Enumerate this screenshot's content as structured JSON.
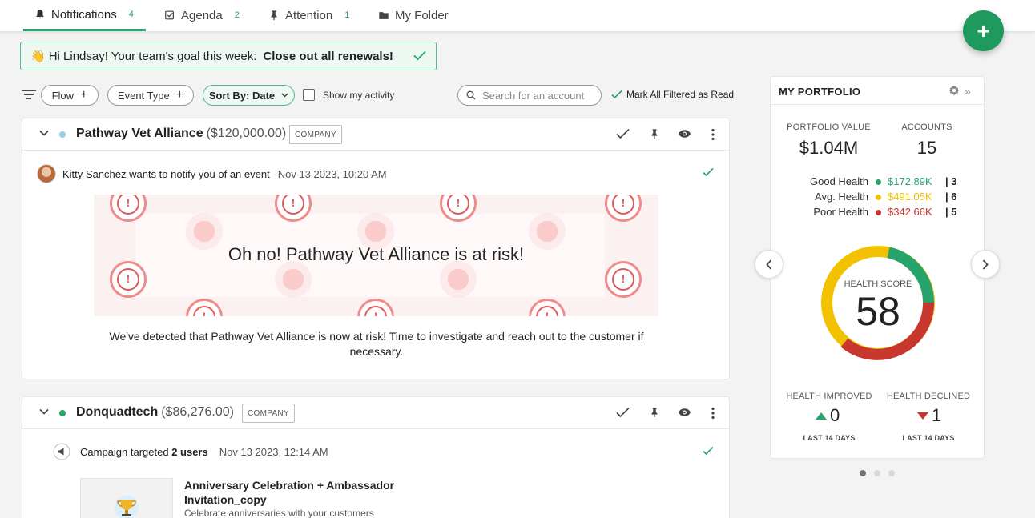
{
  "tabs": [
    {
      "label": "Notifications",
      "count": "4",
      "icon": "bell-icon"
    },
    {
      "label": "Agenda",
      "count": "2",
      "icon": "checklist-icon"
    },
    {
      "label": "Attention",
      "count": "1",
      "icon": "pin-icon"
    },
    {
      "label": "My Folder",
      "count": "",
      "icon": "folder-icon"
    }
  ],
  "fab": {
    "symbol": "+"
  },
  "goal": {
    "emoji": "👋",
    "text": "Hi Lindsay! Your team's goal this week:",
    "highlight": "Close out all renewals!"
  },
  "filters": {
    "flow": "Flow",
    "event_type": "Event Type",
    "sort": "Sort By: Date",
    "show_activity": "Show my activity",
    "search_placeholder": "Search for an account",
    "mark_read": "Mark All Filtered as Read"
  },
  "cards": [
    {
      "name": "Pathway Vet Alliance",
      "value": "($120,000.00)",
      "badge": "COMPANY",
      "dot_color": "#9ccbe8",
      "event_text": "Kitty Sanchez wants to notify you of an event",
      "time": "Nov 13 2023, 10:20 AM",
      "banner_title": "Oh no! Pathway Vet Alliance is at risk!",
      "description": "We've detected that Pathway Vet Alliance is now at risk! Time to investigate and reach out to the customer if necessary."
    },
    {
      "name": "Donquadtech",
      "value": "($86,276.00)",
      "badge": "COMPANY",
      "dot_color": "#27a36b",
      "event_prefix": "Campaign targeted ",
      "event_bold": "2 users",
      "time": "Nov 13 2023, 12:14 AM",
      "campaign_title": "Anniversary Celebration + Ambassador Invitation_copy",
      "campaign_desc": "Celebrate anniversaries with your customers"
    }
  ],
  "portfolio": {
    "title": "MY PORTFOLIO",
    "value_label": "PORTFOLIO VALUE",
    "value": "$1.04M",
    "accounts_label": "ACCOUNTS",
    "accounts": "15",
    "health": [
      {
        "label": "Good Health",
        "amount": "$172.89K",
        "count": "| 3",
        "color": "#27a36b"
      },
      {
        "label": "Avg. Health",
        "amount": "$491.05K",
        "count": "| 6",
        "color": "#f2c200"
      },
      {
        "label": "Poor Health",
        "amount": "$342.66K",
        "count": "| 5",
        "color": "#c8372d"
      }
    ],
    "gauge": {
      "label": "HEALTH SCORE",
      "score": "58"
    },
    "improved_label": "HEALTH IMPROVED",
    "improved": "0",
    "declined_label": "HEALTH DECLINED",
    "declined": "1",
    "period": "LAST 14 DAYS"
  },
  "colors": {
    "accent": "#27a36b",
    "fab": "#1e9a5e",
    "good": "#27a36b",
    "avg": "#f2c200",
    "poor": "#c8372d"
  }
}
